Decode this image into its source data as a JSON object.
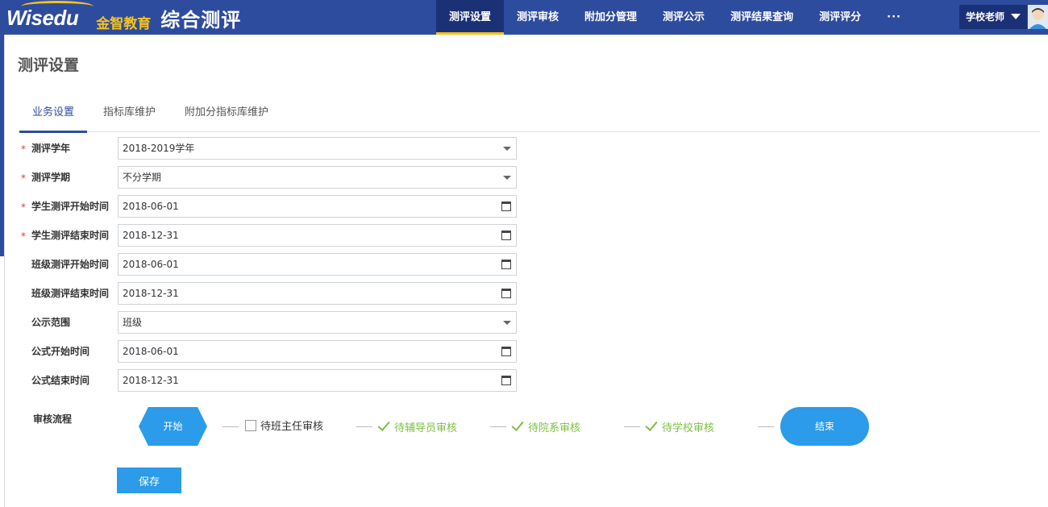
{
  "header": {
    "logo_en": "Wisedu",
    "logo_cn": "金智教育",
    "app_title": "综合测评",
    "nav": [
      {
        "label": "测评设置",
        "active": true
      },
      {
        "label": "测评审核",
        "active": false
      },
      {
        "label": "附加分管理",
        "active": false
      },
      {
        "label": "测评公示",
        "active": false
      },
      {
        "label": "测评结果查询",
        "active": false
      },
      {
        "label": "测评评分",
        "active": false
      }
    ],
    "more_label": "···",
    "user_role": "学校老师"
  },
  "page": {
    "title": "测评设置"
  },
  "tabs": [
    {
      "label": "业务设置",
      "active": true
    },
    {
      "label": "指标库维护",
      "active": false
    },
    {
      "label": "附加分指标库维护",
      "active": false
    }
  ],
  "form": {
    "fields": [
      {
        "label": "测评学年",
        "value": "2018-2019学年",
        "required": true,
        "kind": "select"
      },
      {
        "label": "测评学期",
        "value": "不分学期",
        "required": true,
        "kind": "select"
      },
      {
        "label": "学生测评开始时间",
        "value": "2018-06-01",
        "required": true,
        "kind": "date"
      },
      {
        "label": "学生测评结束时间",
        "value": "2018-12-31",
        "required": true,
        "kind": "date"
      },
      {
        "label": "班级测评开始时间",
        "value": "2018-06-01",
        "required": false,
        "kind": "date"
      },
      {
        "label": "班级测评结束时间",
        "value": "2018-12-31",
        "required": false,
        "kind": "date"
      },
      {
        "label": "公示范围",
        "value": "班级",
        "required": false,
        "kind": "select"
      },
      {
        "label": "公式开始时间",
        "value": "2018-06-01",
        "required": false,
        "kind": "date"
      },
      {
        "label": "公式结束时间",
        "value": "2018-12-31",
        "required": false,
        "kind": "date"
      }
    ],
    "required_mark": "*"
  },
  "workflow": {
    "label": "审核流程",
    "start": "开始",
    "end": "结束",
    "steps": [
      {
        "label": "待班主任审核",
        "checked": false
      },
      {
        "label": "待辅导员审核",
        "checked": true
      },
      {
        "label": "待院系审核",
        "checked": true
      },
      {
        "label": "待学校审核",
        "checked": true
      }
    ]
  },
  "actions": {
    "save_label": "保存"
  },
  "colors": {
    "header_bg": "#2e4c9e",
    "nav_active_bg": "#1b3176",
    "accent_yellow": "#f6c31d",
    "primary_blue": "#2b9bea",
    "check_green": "#7cc043",
    "required_red": "#e53935"
  }
}
